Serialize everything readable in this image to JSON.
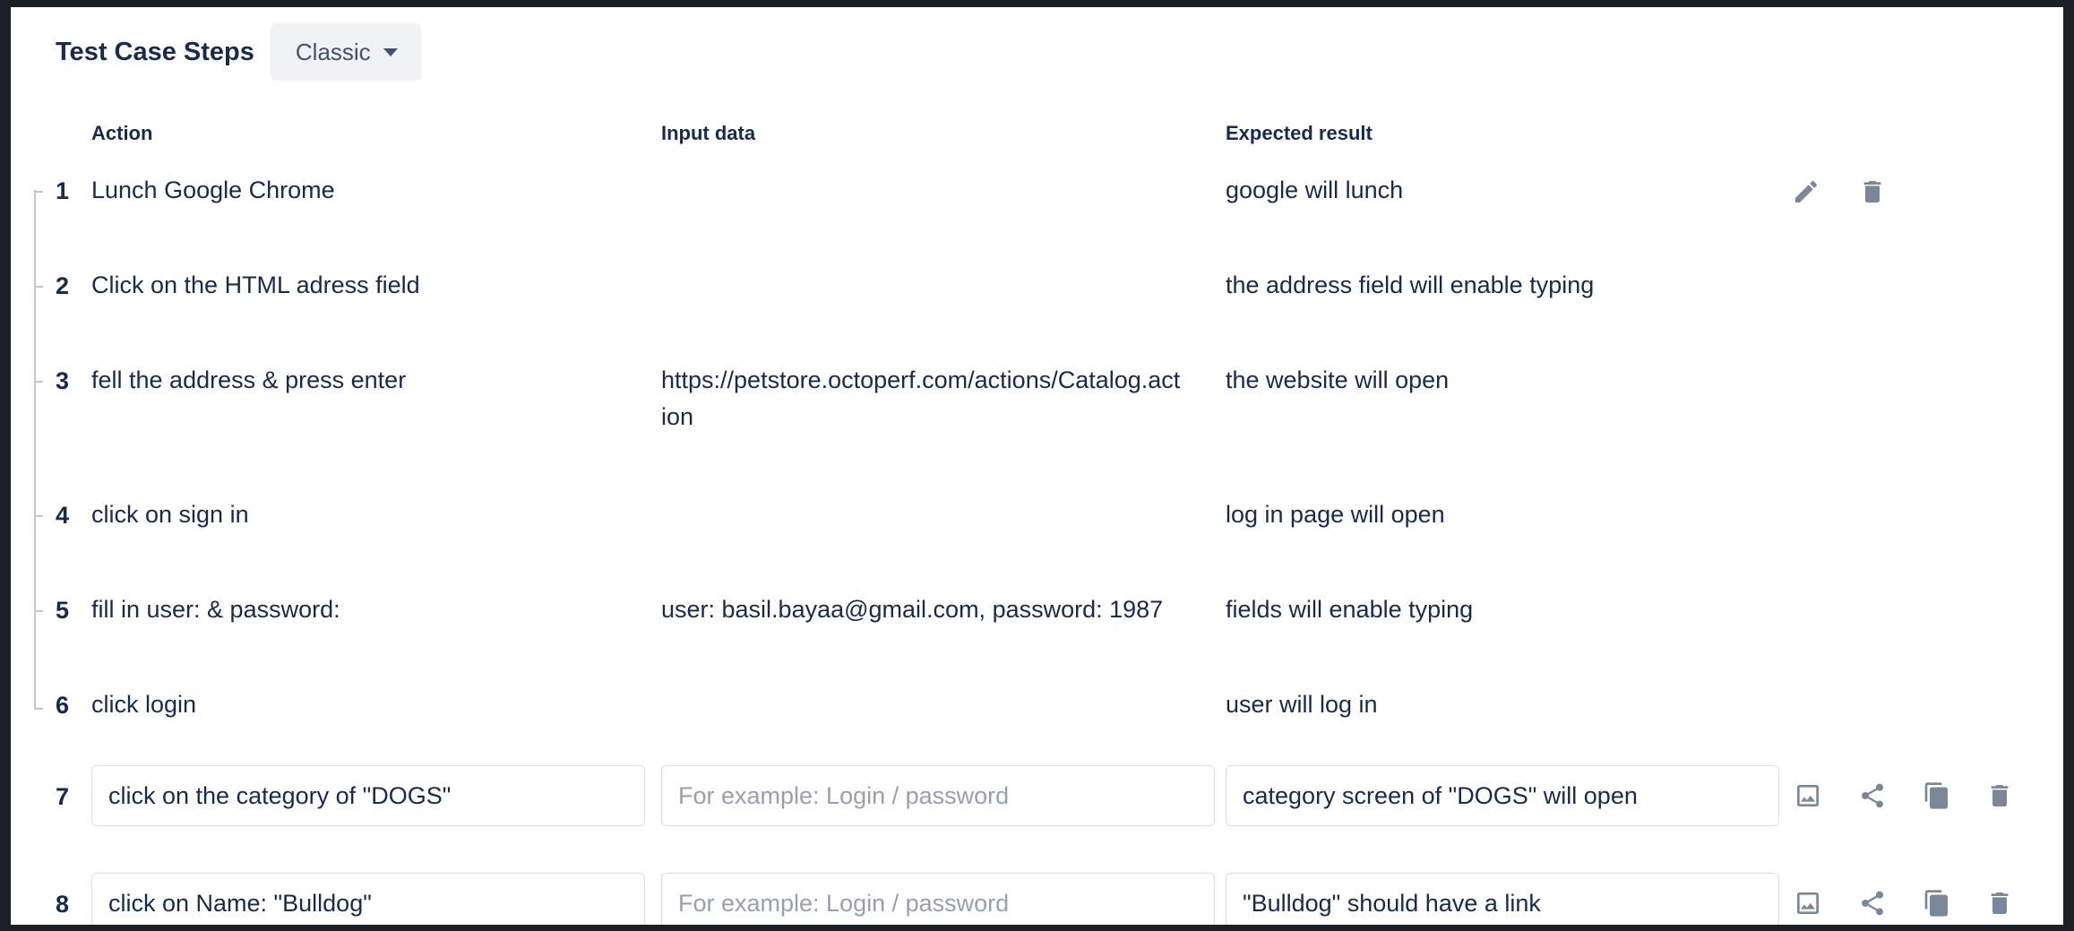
{
  "header": {
    "title": "Test Case Steps",
    "mode": "Classic"
  },
  "columns": {
    "action": "Action",
    "input": "Input data",
    "expected": "Expected result"
  },
  "steps": [
    {
      "num": "1",
      "action": "Lunch Google Chrome",
      "input": "",
      "expected": "google will lunch"
    },
    {
      "num": "2",
      "action": "Click on the HTML adress field",
      "input": "",
      "expected": "the address field will enable typing"
    },
    {
      "num": "3",
      "action": "fell the address & press enter",
      "input_line1": "https://petstore.octoperf.com/actions/Catalog.act",
      "input_line2": "ion",
      "expected": "the website will open"
    },
    {
      "num": "4",
      "action": "click on sign in",
      "input": "",
      "expected": "log in page will open"
    },
    {
      "num": "5",
      "action": "fill in user: & password:",
      "input": "user: basil.bayaa@gmail.com, password: 1987",
      "expected": "fields will enable typing"
    },
    {
      "num": "6",
      "action": "click login",
      "input": "",
      "expected": "user will log in"
    }
  ],
  "edit_rows": [
    {
      "num": "7",
      "action": "click on the category of \"DOGS\"",
      "input_placeholder": "For example: Login / password",
      "expected": "category screen of \"DOGS\" will open"
    },
    {
      "num": "8",
      "action": "click on Name: \"Bulldog\"",
      "input_placeholder": "For example: Login / password",
      "expected": "\"Bulldog\" should have a link"
    }
  ],
  "icons": {
    "edit": "pencil-icon",
    "delete": "trash-icon",
    "image": "image-icon",
    "share": "share-icon",
    "copy": "copy-icon"
  }
}
